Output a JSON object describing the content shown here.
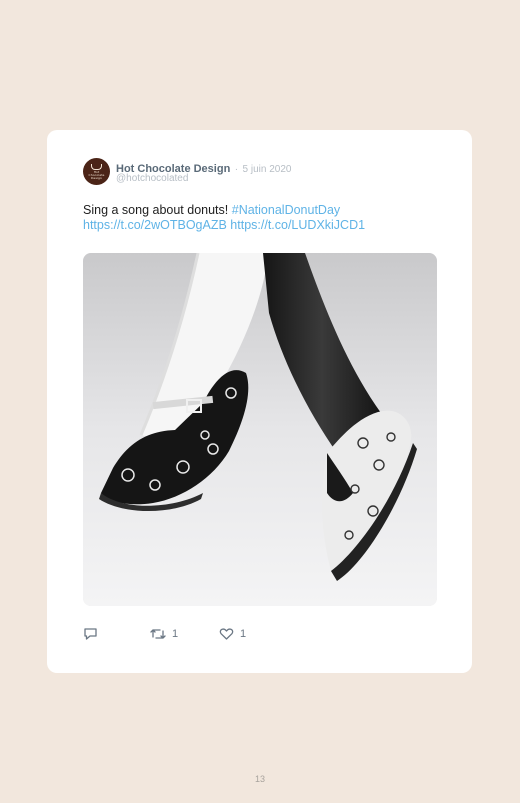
{
  "tweet": {
    "author_name": "Hot Chocolate Design",
    "separator": "·",
    "date": "5 juin 2020",
    "handle": "@hotchocolated",
    "avatar_text": [
      "Hot",
      "Chocolate",
      "Design"
    ],
    "text_plain": "Sing a song about donuts!",
    "hashtag": "#NationalDonutDay",
    "link1": "https://t.co/2wOTBOgAZB",
    "link2": "https://t.co/LUDXkiJCD1",
    "media_alt": "Two legs in tights wearing black and white donut-print Mary Jane shoes",
    "retweet_count": "1",
    "like_count": "1"
  },
  "icons": {
    "reply": "reply-icon",
    "retweet": "retweet-icon",
    "like": "heart-icon"
  },
  "colors": {
    "page_background": "#f2e7dd",
    "card": "#ffffff",
    "link": "#5fb3e6",
    "author": "#5a6a78",
    "muted": "#b7bec5"
  },
  "footer": {
    "page_number": "13"
  }
}
